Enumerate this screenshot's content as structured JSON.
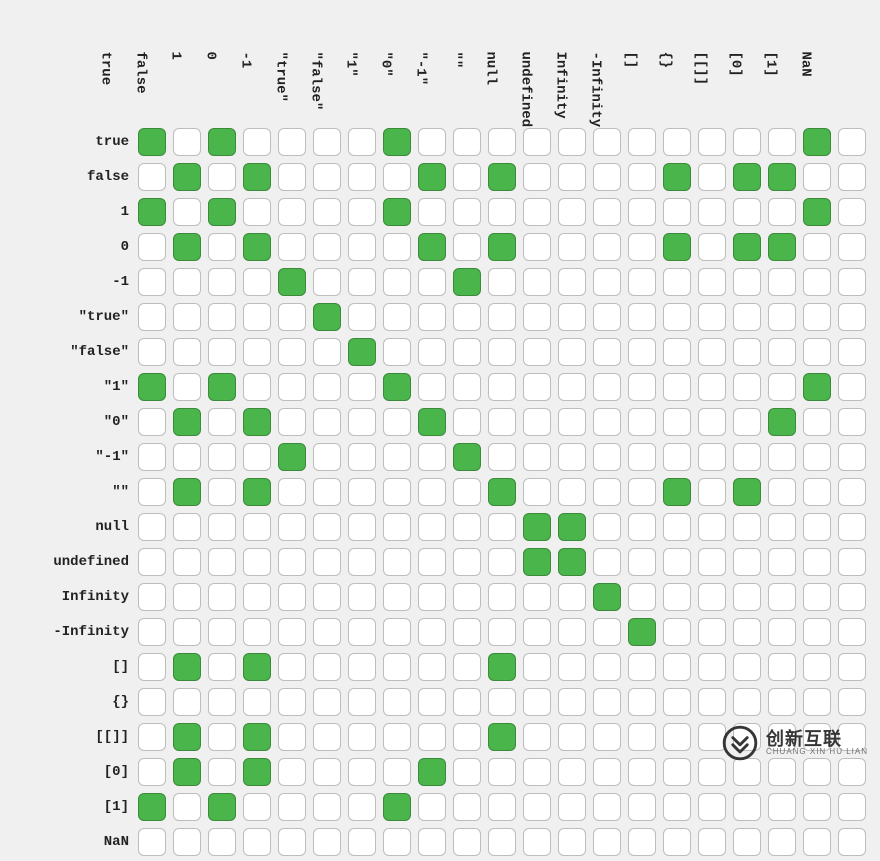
{
  "chart_data": {
    "type": "heatmap",
    "title": "",
    "xlabel": "",
    "ylabel": "",
    "categories": [
      "true",
      "false",
      "1",
      "0",
      "-1",
      "\"true\"",
      "\"false\"",
      "\"1\"",
      "\"0\"",
      "\"-1\"",
      "\"\"",
      "null",
      "undefined",
      "Infinity",
      "-Infinity",
      "[]",
      "{}",
      "[[]]",
      "[0]",
      "[1]",
      "NaN"
    ],
    "row_labels": [
      "true",
      "false",
      "1",
      "0",
      "-1",
      "\"true\"",
      "\"false\"",
      "\"1\"",
      "\"0\"",
      "\"-1\"",
      "\"\"",
      "null",
      "undefined",
      "Infinity",
      "-Infinity",
      "[]",
      "{}",
      "[[]]",
      "[0]",
      "[1]",
      "NaN"
    ],
    "matrix": [
      [
        1,
        0,
        1,
        0,
        0,
        0,
        0,
        1,
        0,
        0,
        0,
        0,
        0,
        0,
        0,
        0,
        0,
        0,
        0,
        1,
        0
      ],
      [
        0,
        1,
        0,
        1,
        0,
        0,
        0,
        0,
        1,
        0,
        1,
        0,
        0,
        0,
        0,
        1,
        0,
        1,
        1,
        0,
        0
      ],
      [
        1,
        0,
        1,
        0,
        0,
        0,
        0,
        1,
        0,
        0,
        0,
        0,
        0,
        0,
        0,
        0,
        0,
        0,
        0,
        1,
        0
      ],
      [
        0,
        1,
        0,
        1,
        0,
        0,
        0,
        0,
        1,
        0,
        1,
        0,
        0,
        0,
        0,
        1,
        0,
        1,
        1,
        0,
        0
      ],
      [
        0,
        0,
        0,
        0,
        1,
        0,
        0,
        0,
        0,
        1,
        0,
        0,
        0,
        0,
        0,
        0,
        0,
        0,
        0,
        0,
        0
      ],
      [
        0,
        0,
        0,
        0,
        0,
        1,
        0,
        0,
        0,
        0,
        0,
        0,
        0,
        0,
        0,
        0,
        0,
        0,
        0,
        0,
        0
      ],
      [
        0,
        0,
        0,
        0,
        0,
        0,
        1,
        0,
        0,
        0,
        0,
        0,
        0,
        0,
        0,
        0,
        0,
        0,
        0,
        0,
        0
      ],
      [
        1,
        0,
        1,
        0,
        0,
        0,
        0,
        1,
        0,
        0,
        0,
        0,
        0,
        0,
        0,
        0,
        0,
        0,
        0,
        1,
        0
      ],
      [
        0,
        1,
        0,
        1,
        0,
        0,
        0,
        0,
        1,
        0,
        0,
        0,
        0,
        0,
        0,
        0,
        0,
        0,
        1,
        0,
        0
      ],
      [
        0,
        0,
        0,
        0,
        1,
        0,
        0,
        0,
        0,
        1,
        0,
        0,
        0,
        0,
        0,
        0,
        0,
        0,
        0,
        0,
        0
      ],
      [
        0,
        1,
        0,
        1,
        0,
        0,
        0,
        0,
        0,
        0,
        1,
        0,
        0,
        0,
        0,
        1,
        0,
        1,
        0,
        0,
        0
      ],
      [
        0,
        0,
        0,
        0,
        0,
        0,
        0,
        0,
        0,
        0,
        0,
        1,
        1,
        0,
        0,
        0,
        0,
        0,
        0,
        0,
        0
      ],
      [
        0,
        0,
        0,
        0,
        0,
        0,
        0,
        0,
        0,
        0,
        0,
        1,
        1,
        0,
        0,
        0,
        0,
        0,
        0,
        0,
        0
      ],
      [
        0,
        0,
        0,
        0,
        0,
        0,
        0,
        0,
        0,
        0,
        0,
        0,
        0,
        1,
        0,
        0,
        0,
        0,
        0,
        0,
        0
      ],
      [
        0,
        0,
        0,
        0,
        0,
        0,
        0,
        0,
        0,
        0,
        0,
        0,
        0,
        0,
        1,
        0,
        0,
        0,
        0,
        0,
        0
      ],
      [
        0,
        1,
        0,
        1,
        0,
        0,
        0,
        0,
        0,
        0,
        1,
        0,
        0,
        0,
        0,
        0,
        0,
        0,
        0,
        0,
        0
      ],
      [
        0,
        0,
        0,
        0,
        0,
        0,
        0,
        0,
        0,
        0,
        0,
        0,
        0,
        0,
        0,
        0,
        0,
        0,
        0,
        0,
        0
      ],
      [
        0,
        1,
        0,
        1,
        0,
        0,
        0,
        0,
        0,
        0,
        1,
        0,
        0,
        0,
        0,
        0,
        0,
        0,
        0,
        0,
        0
      ],
      [
        0,
        1,
        0,
        1,
        0,
        0,
        0,
        0,
        1,
        0,
        0,
        0,
        0,
        0,
        0,
        0,
        0,
        0,
        0,
        0,
        0
      ],
      [
        1,
        0,
        1,
        0,
        0,
        0,
        0,
        1,
        0,
        0,
        0,
        0,
        0,
        0,
        0,
        0,
        0,
        0,
        0,
        0,
        0
      ],
      [
        0,
        0,
        0,
        0,
        0,
        0,
        0,
        0,
        0,
        0,
        0,
        0,
        0,
        0,
        0,
        0,
        0,
        0,
        0,
        0,
        0
      ]
    ],
    "color_true": "#4ab54a",
    "color_false": "#ffffff"
  },
  "watermark": {
    "cn": "创新互联",
    "en": "CHUANG XIN HU LIAN"
  }
}
